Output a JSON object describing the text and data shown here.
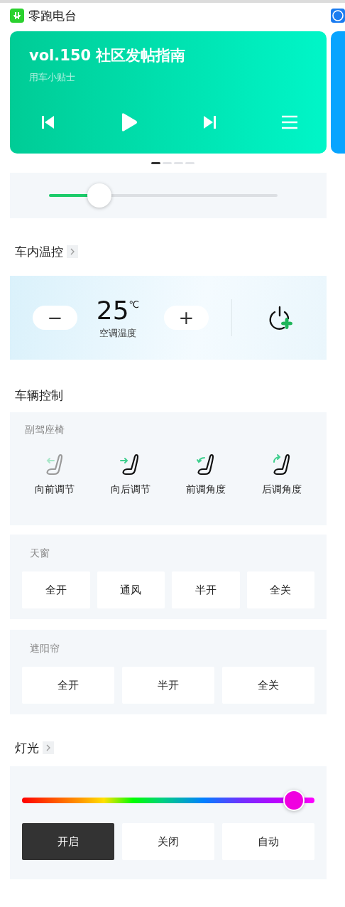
{
  "radio": {
    "app_name": "零跑电台",
    "title": "vol.150 社区发帖指南",
    "subtitle": "用车小贴士"
  },
  "carousel_pages": [
    {
      "selected": true
    },
    {
      "selected": false
    },
    {
      "selected": false
    },
    {
      "selected": false
    }
  ],
  "volume": {
    "level": 0.22
  },
  "climate": {
    "heading": "车内温控",
    "minus": "−",
    "temperature": "25",
    "unit": "℃",
    "label": "空调温度",
    "plus": "+"
  },
  "vehicle": {
    "heading": "车辆控制",
    "seat": {
      "title": "副驾座椅",
      "actions": [
        {
          "label": "向前调节",
          "kind": "forward",
          "disabled": true
        },
        {
          "label": "向后调节",
          "kind": "backward",
          "disabled": false
        },
        {
          "label": "前调角度",
          "kind": "tilt-forward",
          "disabled": false
        },
        {
          "label": "后调角度",
          "kind": "tilt-back",
          "disabled": false
        }
      ]
    },
    "sunroof": {
      "title": "天窗",
      "buttons": [
        "全开",
        "通风",
        "半开",
        "全关"
      ]
    },
    "sunshade": {
      "title": "遮阳帘",
      "buttons": [
        "全开",
        "半开",
        "全关"
      ]
    }
  },
  "lights": {
    "heading": "灯光",
    "hue": {
      "level": 0.93
    },
    "modes": [
      {
        "label": "开启",
        "selected": true
      },
      {
        "label": "关闭",
        "selected": false
      },
      {
        "label": "自动",
        "selected": false
      }
    ]
  }
}
